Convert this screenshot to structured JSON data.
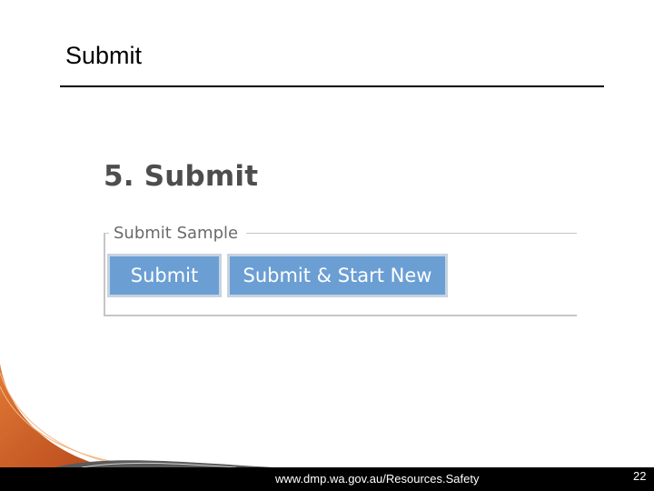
{
  "slide": {
    "title": "Submit"
  },
  "section": {
    "heading": "5. Submit"
  },
  "fieldset": {
    "legend": "Submit Sample",
    "buttons": {
      "submit_label": "Submit",
      "submit_start_new_label": "Submit & Start New"
    }
  },
  "footer": {
    "url": "www.dmp.wa.gov.au/Resources.Safety",
    "page_number": "22"
  },
  "colors": {
    "button_fill": "#6b9fd4",
    "button_border": "#c6d3e0",
    "swoosh_orange": "#d4662a",
    "footer_bg": "#000000"
  }
}
